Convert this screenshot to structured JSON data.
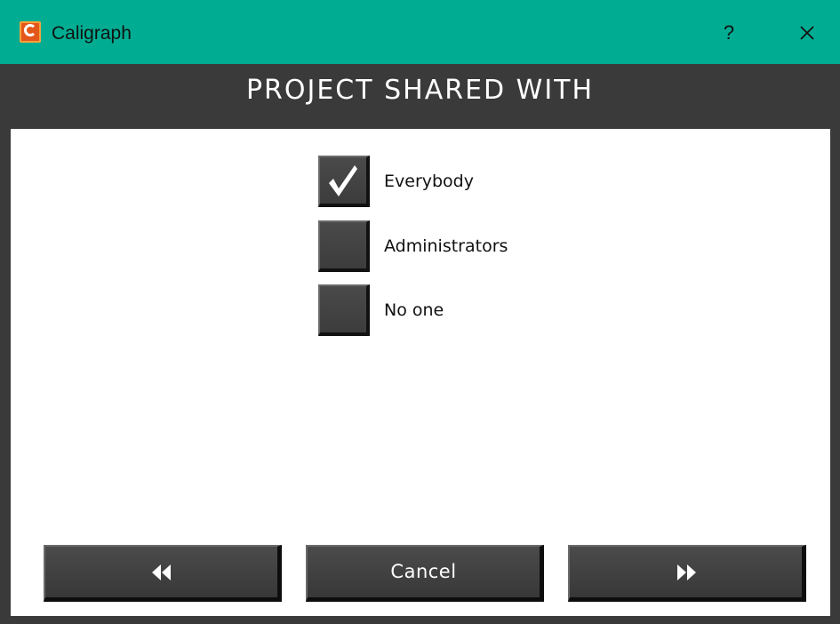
{
  "window": {
    "app_title": "Caligraph",
    "help_label": "?",
    "icons": {
      "app": "caligraph-logo-icon",
      "close": "close-icon"
    },
    "accent_color": "#00ad92"
  },
  "header": {
    "title": "PROJECT SHARED WITH"
  },
  "options": [
    {
      "label": "Everybody",
      "checked": true
    },
    {
      "label": "Administrators",
      "checked": false
    },
    {
      "label": "No one",
      "checked": false
    }
  ],
  "footer": {
    "back_icon": "rewind-icon",
    "cancel_label": "Cancel",
    "next_icon": "fast-forward-icon"
  }
}
